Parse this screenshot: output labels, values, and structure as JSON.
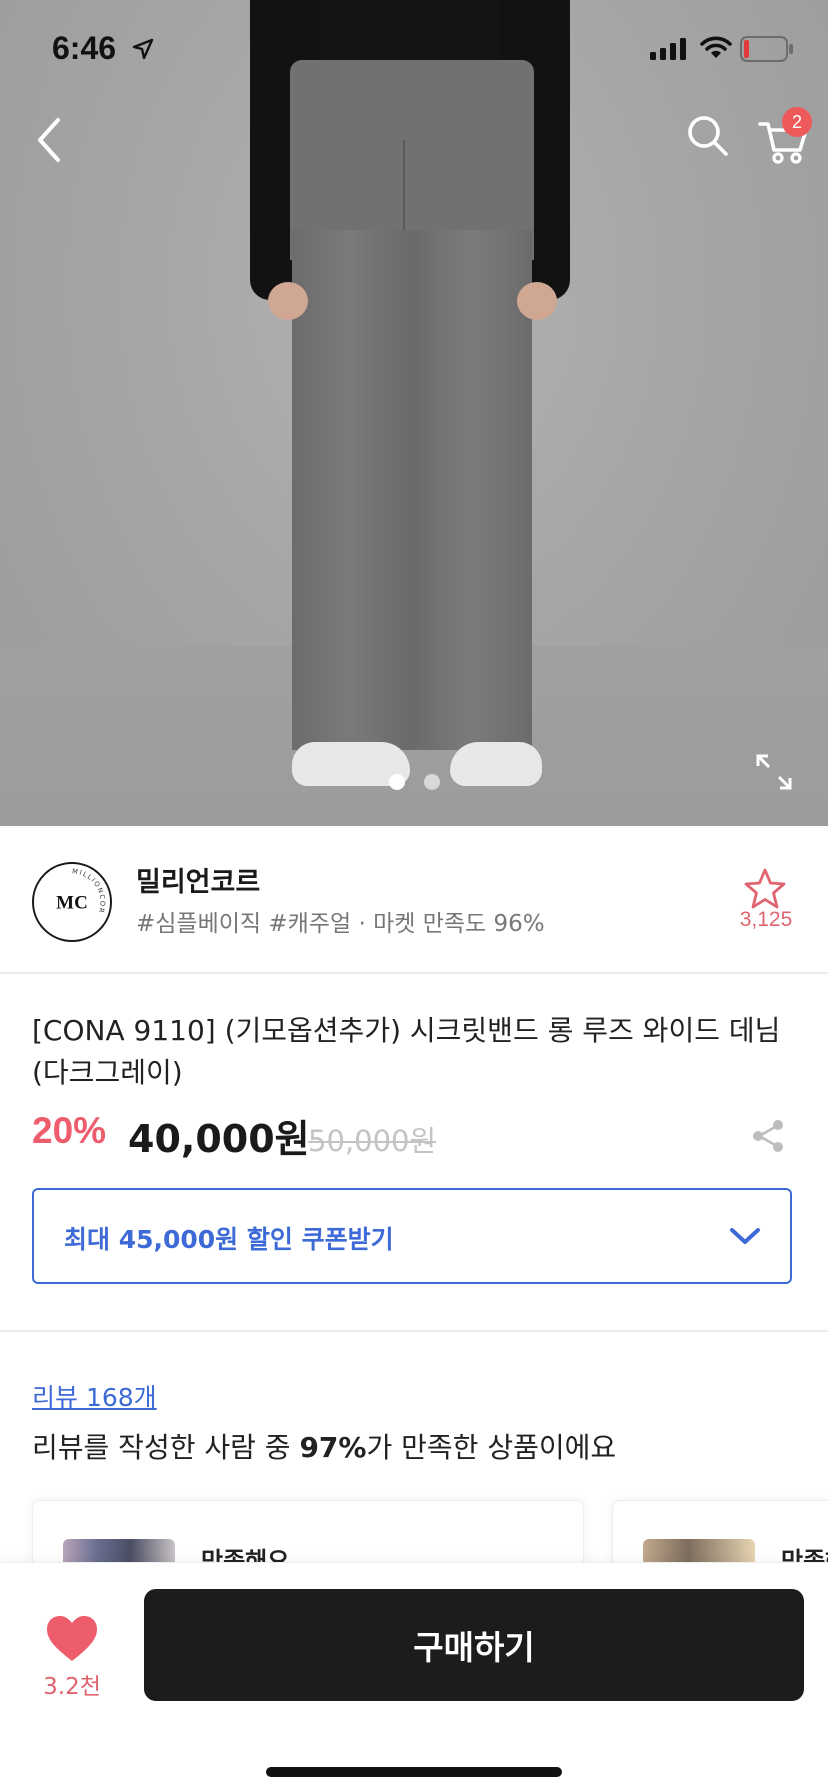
{
  "status_bar": {
    "time": "6:46"
  },
  "header": {
    "cart_count": "2"
  },
  "hero": {
    "dots": 2,
    "active_dot": 1
  },
  "shop": {
    "name": "밀리언코르",
    "tags": "#심플베이직 #캐주얼 · 마켓 만족도 96%",
    "favorite_count": "3,125",
    "logo_initials": "MC",
    "logo_ring_text": "MILLIONCOR"
  },
  "product": {
    "title": "[CONA 9110] (기모옵션추가) 시크릿밴드 롱 루즈 와이드 데님 (다크그레이)",
    "discount": "20%",
    "price": "40,000원",
    "original_price": "50,000원"
  },
  "coupon": {
    "label": "최대 45,000원 할인 쿠폰받기"
  },
  "reviews": {
    "link": "리뷰 168개",
    "summary_prefix": "리뷰를 작성한 사람 중 ",
    "summary_percent": "97%",
    "summary_suffix": "가 만족한 상품이에요",
    "cards": [
      {
        "label": "만족해요"
      },
      {
        "label": "만족해요"
      }
    ]
  },
  "bottom_bar": {
    "like_count": "3.2천",
    "buy_label": "구매하기"
  },
  "colors": {
    "accent_blue": "#3d6ad6",
    "accent_red": "#ee5d6c",
    "buy_button": "#1c1c1c"
  }
}
